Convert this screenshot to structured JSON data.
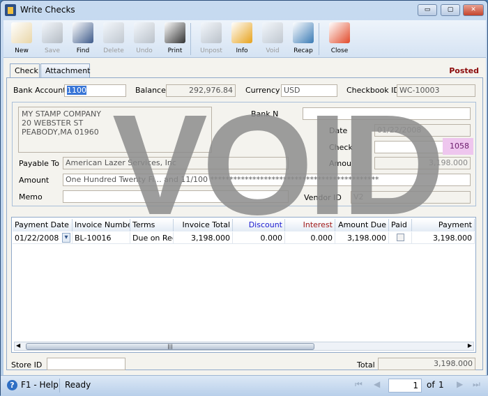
{
  "window": {
    "title": "Write Checks",
    "minimize": "▭",
    "maximize": "▢",
    "close": "✕"
  },
  "toolbar": [
    {
      "label": "New",
      "icon": "new-icon",
      "enabled": true,
      "color": "#e9d6a8"
    },
    {
      "label": "Save",
      "icon": "save-icon",
      "enabled": false,
      "color": "#666"
    },
    {
      "label": "Find",
      "icon": "binoculars-icon",
      "enabled": true,
      "color": "#3d5a8a"
    },
    {
      "label": "Delete",
      "icon": "trash-icon",
      "enabled": false,
      "color": "#888"
    },
    {
      "label": "Undo",
      "icon": "undo-icon",
      "enabled": false,
      "color": "#777"
    },
    {
      "label": "Print",
      "icon": "printer-icon",
      "enabled": true,
      "color": "#333"
    },
    {
      "label": "Unpost",
      "icon": "unpost-icon",
      "enabled": false,
      "color": "#777"
    },
    {
      "label": "Info",
      "icon": "info-icon",
      "enabled": true,
      "color": "#e7a21c"
    },
    {
      "label": "Void",
      "icon": "void-icon",
      "enabled": false,
      "color": "#888"
    },
    {
      "label": "Recap",
      "icon": "recap-icon",
      "enabled": true,
      "color": "#3a7bb5"
    },
    {
      "label": "Close",
      "icon": "close-form-icon",
      "enabled": true,
      "color": "#e24a2a"
    }
  ],
  "tabs": [
    {
      "label": "Check",
      "active": true
    },
    {
      "label": "Attachment",
      "active": false
    }
  ],
  "status_label": "Posted",
  "header": {
    "bank_account_label": "Bank Account",
    "bank_account": "1100",
    "balance_label": "Balance",
    "balance": "292,976.84",
    "currency_label": "Currency",
    "currency": "USD",
    "checkbook_label": "Checkbook ID",
    "checkbook": "WC-10003"
  },
  "check": {
    "address": [
      "MY STAMP COMPANY",
      "20 WEBSTER ST",
      "PEABODY,MA 01960"
    ],
    "bank_name_label": "Bank N",
    "bank_name": "",
    "date_label": "Date",
    "date": "01/22/2008",
    "check_label": "Check",
    "check_no": "1058",
    "amount_num_label": "Amou",
    "amount_num": "3,198.000",
    "payable_label": "Payable To",
    "payable": "American Lazer Services, Inc",
    "amount_label": "Amount",
    "amount_words": "One Hundred Twenty Fi... and 11/100 ********************************************",
    "memo_label": "Memo",
    "memo": "",
    "vendor_label": "Vendor ID",
    "vendor": "V2",
    "watermark": "VOID"
  },
  "grid": {
    "columns": [
      "Payment Date",
      "Invoice Number",
      "Terms",
      "Invoice Total",
      "Discount",
      "Interest",
      "Amount Due",
      "Paid",
      "Payment"
    ],
    "column_colors": {
      "Discount": "#1a1ad0",
      "Interest": "#a01818"
    },
    "rows": [
      [
        "01/22/2008",
        "BL-10016",
        "Due on Receipt",
        "3,198.000",
        "0.000",
        "0.000",
        "3,198.000",
        false,
        "3,198.000"
      ]
    ]
  },
  "footer": {
    "store_label": "Store ID",
    "store": "",
    "total_label": "Total",
    "total": "3,198.000"
  },
  "statusbar": {
    "help": "F1 - Help",
    "state": "Ready",
    "page": "1",
    "of": "of",
    "pages": "1"
  }
}
